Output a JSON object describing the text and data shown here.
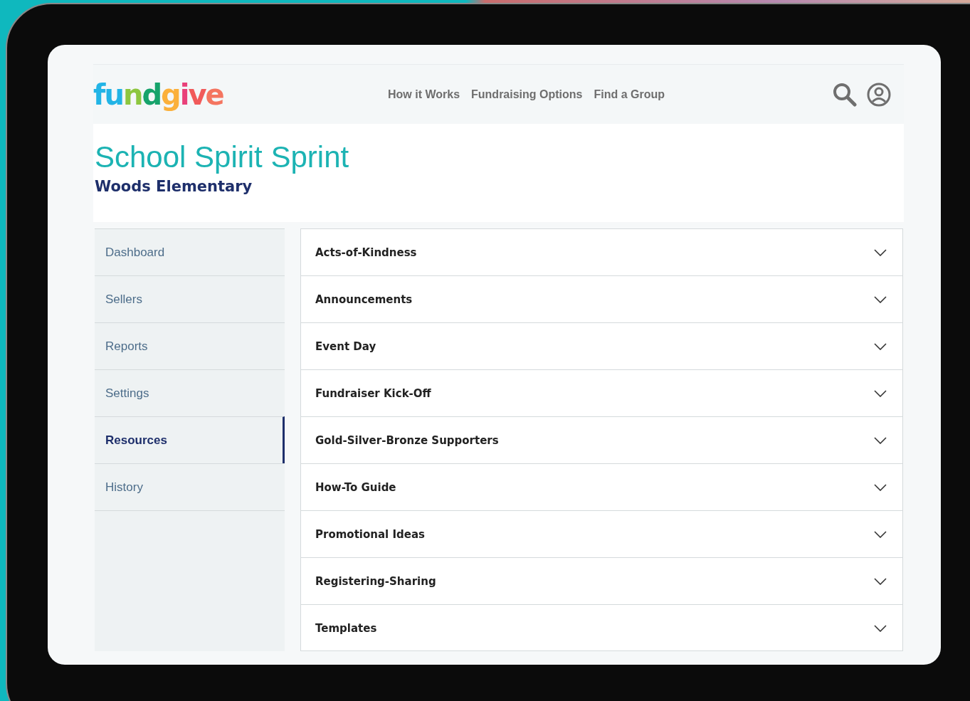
{
  "header": {
    "logo": "fundgive",
    "nav": [
      "How it Works",
      "Fundraising Options",
      "Find a Group"
    ]
  },
  "page": {
    "title": "School Spirit Sprint",
    "subtitle": "Woods Elementary"
  },
  "sidebar": {
    "items": [
      {
        "label": "Dashboard",
        "selected": false
      },
      {
        "label": "Sellers",
        "selected": false
      },
      {
        "label": "Reports",
        "selected": false
      },
      {
        "label": "Settings",
        "selected": false
      },
      {
        "label": "Resources",
        "selected": true
      },
      {
        "label": "History",
        "selected": false
      }
    ]
  },
  "resources": [
    {
      "label": "Acts-of-Kindness",
      "expanded": false
    },
    {
      "label": "Announcements",
      "expanded": false
    },
    {
      "label": "Event Day",
      "expanded": false
    },
    {
      "label": "Fundraiser Kick-Off",
      "expanded": false
    },
    {
      "label": "Gold-Silver-Bronze Supporters",
      "expanded": false
    },
    {
      "label": "How-To Guide",
      "expanded": false
    },
    {
      "label": "Promotional Ideas",
      "expanded": false
    },
    {
      "label": "Registering-Sharing",
      "expanded": false
    },
    {
      "label": "Templates",
      "expanded": false
    }
  ]
}
